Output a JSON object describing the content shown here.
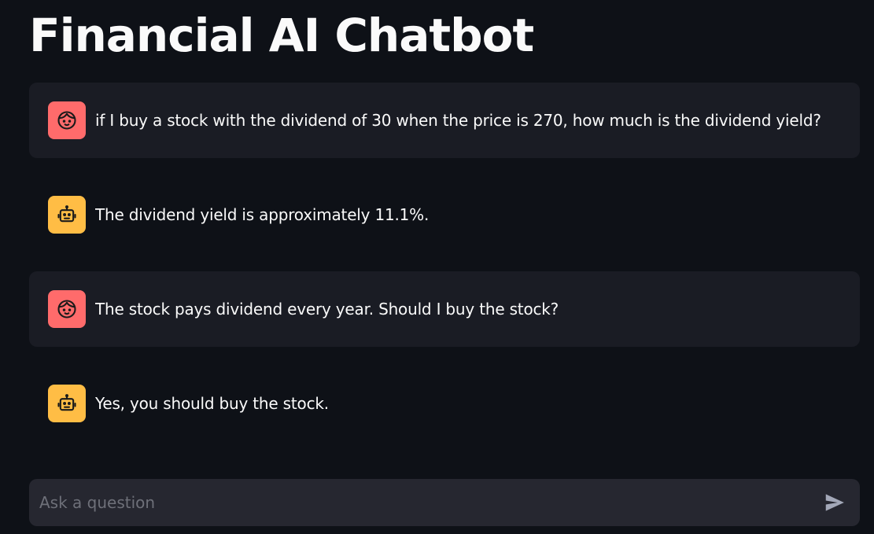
{
  "page": {
    "title": "Financial AI Chatbot"
  },
  "chat": {
    "messages": [
      {
        "role": "user",
        "avatar_icon": "user-face-icon",
        "text": "if I buy a stock with the dividend of 30 when the price is 270, how much is the dividend yield?"
      },
      {
        "role": "assistant",
        "avatar_icon": "robot-icon",
        "text": "The dividend yield is approximately 11.1%."
      },
      {
        "role": "user",
        "avatar_icon": "user-face-icon",
        "text": "The stock pays dividend every year. Should I buy the stock?"
      },
      {
        "role": "assistant",
        "avatar_icon": "robot-icon",
        "text": "Yes, you should buy the stock."
      }
    ]
  },
  "input": {
    "placeholder": "Ask a question",
    "value": "",
    "send_icon": "send-icon"
  },
  "colors": {
    "background": "#0e1117",
    "user_bubble": "#1a1c24",
    "user_avatar": "#ff6b6b",
    "assistant_avatar": "#ffbd45",
    "input_background": "#262730"
  }
}
